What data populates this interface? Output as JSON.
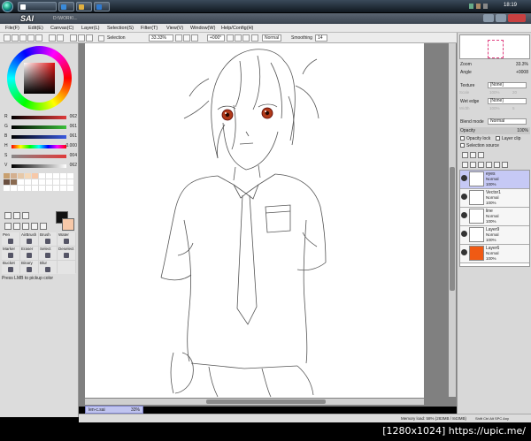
{
  "taskbar": {
    "clock": "18:19"
  },
  "app": {
    "title": "SAI",
    "path": "D:\\WORK\\..."
  },
  "menu": [
    "File(F)",
    "Edit(E)",
    "Canvas(C)",
    "Layer(L)",
    "Selection(S)",
    "Filter(T)",
    "View(V)",
    "Window(W)",
    "Help/Config(H)"
  ],
  "toolbar": {
    "selection_label": "Selection",
    "zoom": "33.33%",
    "angle": "+000°",
    "mode": "Normal",
    "smoothing_label": "Smoothing",
    "smoothing_value": "14"
  },
  "sliders": [
    {
      "letter": "R",
      "value": "062",
      "color": "#e03a3a"
    },
    {
      "letter": "G",
      "value": "061",
      "color": "#3ac03a"
    },
    {
      "letter": "B",
      "value": "061",
      "color": "#3a5ae0"
    },
    {
      "letter": "H",
      "value": "0.000",
      "color": "#ff0000"
    },
    {
      "letter": "S",
      "value": "004",
      "color": "#909090"
    },
    {
      "letter": "V",
      "value": "062",
      "color": "#555555"
    }
  ],
  "swatch_colors": [
    "#c8a070",
    "#d4b090",
    "#e6c8a8",
    "#f4d8b8",
    "#f7c8a8",
    "#ffffff",
    "#ffffff",
    "#ffffff",
    "#ffffff",
    "#ffffff",
    "#6a5040",
    "#8a6a50",
    "#ffffff",
    "#ffffff",
    "#ffffff",
    "#ffffff",
    "#ffffff",
    "#ffffff",
    "#ffffff",
    "#ffffff",
    "#ffffff",
    "#ffffff",
    "#ffffff",
    "#ffffff",
    "#ffffff",
    "#ffffff",
    "#ffffff",
    "#ffffff",
    "#ffffff",
    "#ffffff"
  ],
  "brush_tools": [
    "Pen",
    "AirBrush",
    "Brush",
    "Water",
    "Marker",
    "Eraser",
    "Select",
    "Deselect",
    "Bucket",
    "Binary",
    "Blur",
    ""
  ],
  "status_hint": "Press LMB to pickup color",
  "document": {
    "name": "len-c.sai",
    "zoom": "33%"
  },
  "statusbar": {
    "memory": "Memory load: 58% (283MB / 843MB)",
    "keys": "Shift Ctrl Alt SPC Any"
  },
  "navigator": {
    "zoom_label": "Zoom",
    "zoom_value": "33.3%",
    "angle_label": "Angle",
    "angle_value": "+0008"
  },
  "texture": {
    "label": "Texture",
    "value": "[None]"
  },
  "texture_sub": [
    "Scale",
    "100%",
    "20"
  ],
  "wet_edge": {
    "label": "Wet edge",
    "value": "[None]"
  },
  "wet_edge_sub": [
    "Width",
    "100%",
    "5"
  ],
  "blend": {
    "label": "Blend mode",
    "value": "Normal"
  },
  "opacity": {
    "label": "Opacity",
    "value": "100%"
  },
  "checks": {
    "opacity_lock": "Opacity lock",
    "layer_clip": "Layer clip",
    "selection_source": "Selection source"
  },
  "layers": [
    {
      "name": "eyes",
      "mode": "Normal",
      "opacity": "100%",
      "selected": true,
      "thumb": "#ffffff"
    },
    {
      "name": "Vector1",
      "mode": "Normal",
      "opacity": "100%",
      "selected": false,
      "thumb": "#ffffff"
    },
    {
      "name": "line",
      "mode": "Normal",
      "opacity": "100%",
      "selected": false,
      "thumb": "#ffffff"
    },
    {
      "name": "Layer9",
      "mode": "Normal",
      "opacity": "100%",
      "selected": false,
      "thumb": "#ffffff"
    },
    {
      "name": "Layer6",
      "mode": "Normal",
      "opacity": "100%",
      "selected": false,
      "thumb": "#f05a14"
    }
  ],
  "watermark": "[1280x1024] https://upic.me/"
}
